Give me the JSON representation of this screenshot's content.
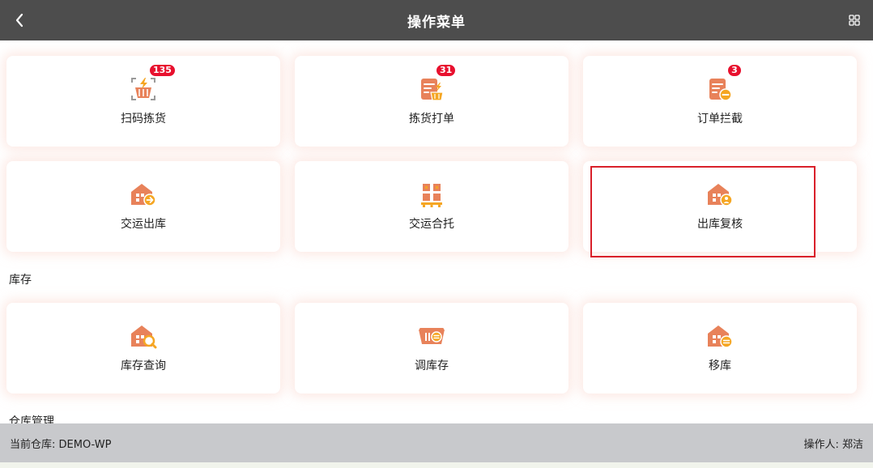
{
  "header": {
    "title": "操作菜单"
  },
  "menu_items": [
    {
      "label": "扫码拣货",
      "badge": "135",
      "icon": "scan-basket-icon"
    },
    {
      "label": "拣货打单",
      "badge": "31",
      "icon": "pick-print-icon"
    },
    {
      "label": "订单拦截",
      "badge": "3",
      "icon": "order-intercept-icon"
    },
    {
      "label": "交运出库",
      "icon": "ship-outbound-icon"
    },
    {
      "label": "交运合托",
      "icon": "pallet-merge-icon"
    },
    {
      "label": "出库复核",
      "icon": "outbound-review-icon"
    }
  ],
  "sections": [
    {
      "title": "库存",
      "items": [
        {
          "label": "库存查询",
          "icon": "inventory-search-icon"
        },
        {
          "label": "调库存",
          "icon": "adjust-inventory-icon"
        },
        {
          "label": "移库",
          "icon": "transfer-icon"
        }
      ]
    },
    {
      "title": "仓库管理"
    }
  ],
  "footer": {
    "warehouse": "当前仓库: DEMO-WP",
    "operator": "操作人: 郑洁"
  },
  "colors": {
    "header_bg": "#4d4d4d",
    "accent": "#e8825a",
    "badge": "#e8102e",
    "highlight": "#d9202a",
    "footer_bg": "#c8c9cc"
  }
}
